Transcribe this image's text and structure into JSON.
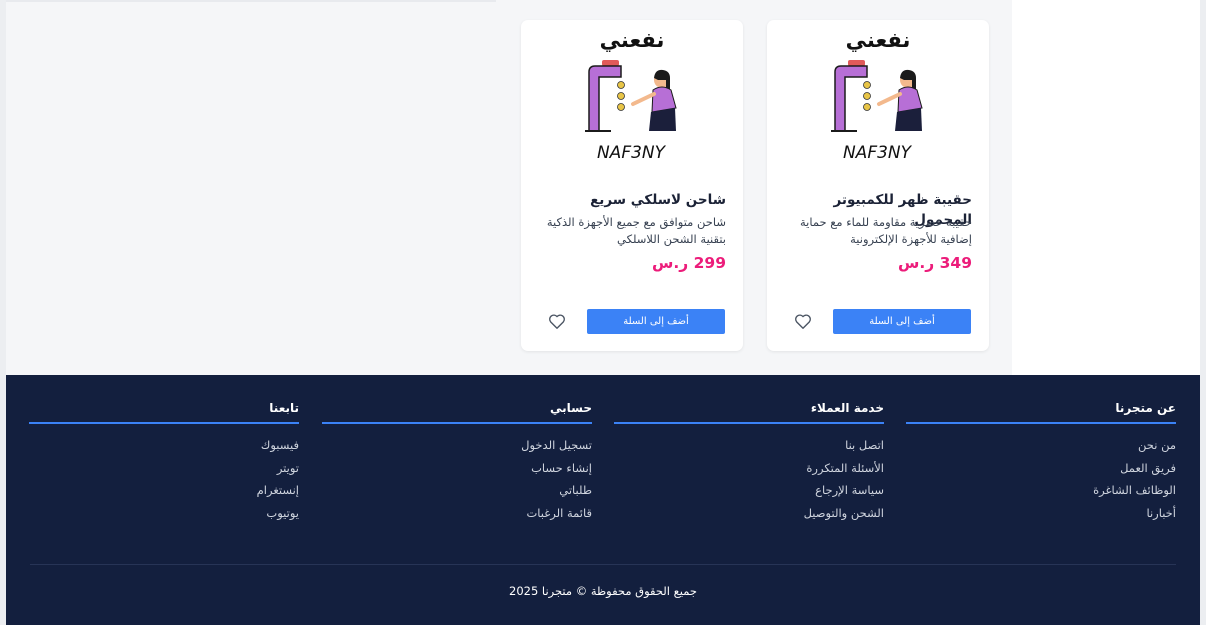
{
  "products": [
    {
      "title": "حقيبة ظهر للكمبيوتر المحمول",
      "description": "حقيبة عصرية مقاومة للماء مع حماية إضافية للأجهزة الإلكترونية",
      "price": "349 ر.س",
      "add_to_cart": "أضف إلى السلة",
      "image": {
        "brand_ar": "نفعني",
        "brand_en": "NAF3NY"
      }
    },
    {
      "title": "شاحن لاسلكي سريع",
      "description": "شاحن متوافق مع جميع الأجهزة الذكية بتقنية الشحن اللاسلكي",
      "price": "299 ر.س",
      "add_to_cart": "أضف إلى السلة",
      "image": {
        "brand_ar": "نفعني",
        "brand_en": "NAF3NY"
      }
    }
  ],
  "footer": {
    "columns": [
      {
        "title": "عن متجرنا",
        "links": [
          "من نحن",
          "فريق العمل",
          "الوظائف الشاغرة",
          "أخبارنا"
        ]
      },
      {
        "title": "خدمة العملاء",
        "links": [
          "اتصل بنا",
          "الأسئلة المتكررة",
          "سياسة الإرجاع",
          "الشحن والتوصيل"
        ]
      },
      {
        "title": "حسابي",
        "links": [
          "تسجيل الدخول",
          "إنشاء حساب",
          "طلباتي",
          "قائمة الرغبات"
        ]
      },
      {
        "title": "تابعنا",
        "links": [
          "فيسبوك",
          "تويتر",
          "إنستغرام",
          "يوتيوب"
        ]
      }
    ],
    "copyright": "جميع الحقوق محفوظة © متجرنا 2025"
  },
  "icons": {
    "wishlist": "heart-icon"
  },
  "colors": {
    "accent": "#3b82f6",
    "price": "#ec1c7a",
    "footer_bg": "#131f3e",
    "page_bg": "#f5f6f8"
  }
}
